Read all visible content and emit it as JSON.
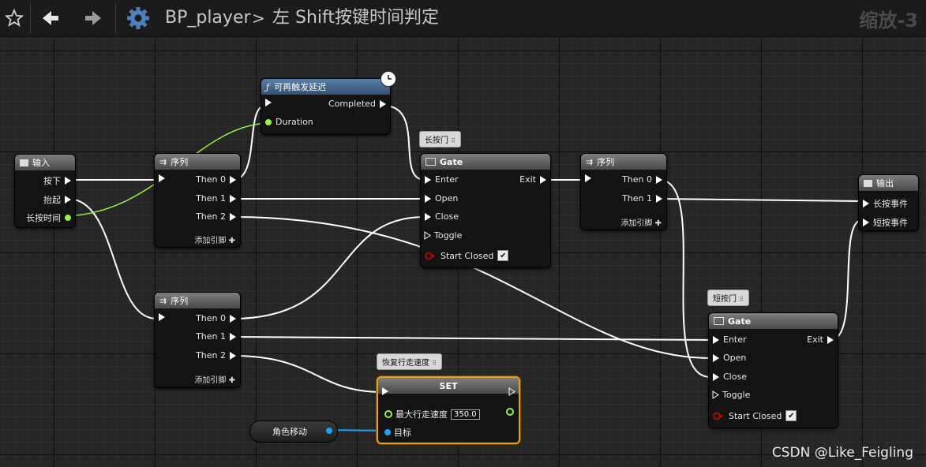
{
  "toolbar": {
    "blueprint": "BP_player",
    "separator": ">",
    "graph": "左 Shift按键时间判定",
    "zoom": "缩放-3",
    "icons": [
      "star-icon",
      "back-arrow-icon",
      "forward-arrow-icon",
      "gear-icon"
    ]
  },
  "nodes": {
    "input": {
      "title": "输入",
      "pins": [
        "按下",
        "抬起",
        "长按时间"
      ]
    },
    "retrigger": {
      "title": "可再触发延迟",
      "completed": "Completed",
      "duration": "Duration"
    },
    "seq1": {
      "title": "序列",
      "then0": "Then 0",
      "then1": "Then 1",
      "then2": "Then 2",
      "add": "添加引脚"
    },
    "seq2": {
      "title": "序列",
      "then0": "Then 0",
      "then1": "Then 1",
      "then2": "Then 2",
      "add": "添加引脚"
    },
    "seq3": {
      "title": "序列",
      "then0": "Then 0",
      "then1": "Then 1",
      "add": "添加引脚"
    },
    "gate1": {
      "comment": "长按门",
      "title": "Gate",
      "enter": "Enter",
      "open": "Open",
      "close": "Close",
      "toggle": "Toggle",
      "start_closed": "Start Closed",
      "exit": "Exit"
    },
    "gate2": {
      "comment": "短按门",
      "title": "Gate",
      "enter": "Enter",
      "open": "Open",
      "close": "Close",
      "toggle": "Toggle",
      "start_closed": "Start Closed",
      "exit": "Exit"
    },
    "output": {
      "title": "输出",
      "pins": [
        "长按事件",
        "短按事件"
      ]
    },
    "set": {
      "comment": "恢复行走速度",
      "title": "SET",
      "field": "最大行走速度",
      "value": "350.0",
      "target": "目标"
    },
    "var": {
      "label": "角色移动"
    }
  },
  "colors": {
    "exec": "#ffffff",
    "float": "#9bf04e",
    "object": "#19a4ef",
    "bool": "#8e0000",
    "set_border": "#e0a020"
  },
  "watermark": "CSDN @Like_Feigling"
}
